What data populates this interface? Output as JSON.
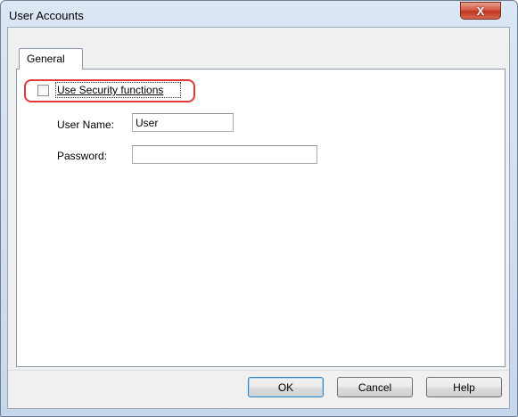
{
  "window": {
    "title": "User Accounts",
    "close_symbol": "X"
  },
  "tabs": [
    {
      "label": "General",
      "selected": true
    }
  ],
  "security": {
    "checkbox_label": "Use Security functions",
    "checked": false
  },
  "fields": {
    "user_name_label": "User Name:",
    "user_name_value": "User",
    "password_label": "Password:",
    "password_value": ""
  },
  "buttons": {
    "ok": "OK",
    "cancel": "Cancel",
    "help": "Help"
  },
  "colors": {
    "highlight_ring": "#e03a3a",
    "close_button": "#c1351d",
    "frame": "#c7d7eb"
  }
}
